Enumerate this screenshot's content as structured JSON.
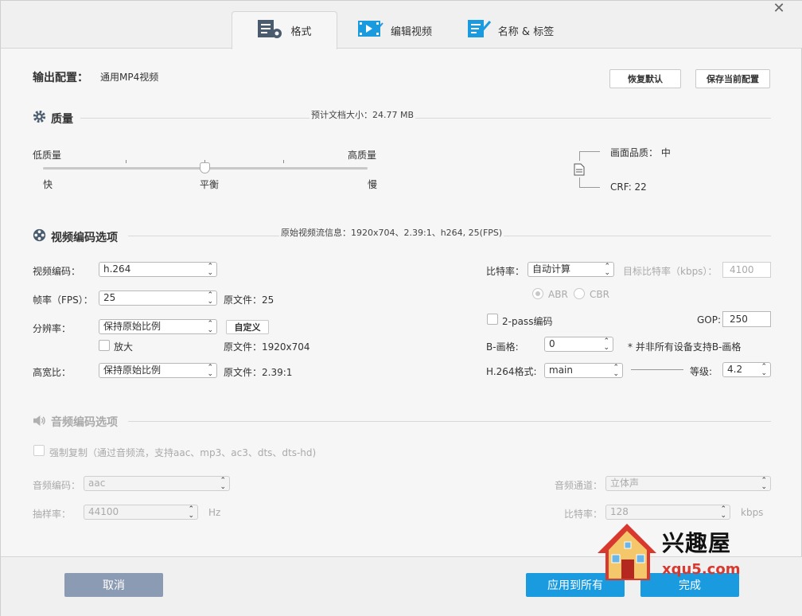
{
  "tabs": [
    {
      "label": "格式",
      "icon": "format-icon"
    },
    {
      "label": "编辑视频",
      "icon": "edit-video-icon"
    },
    {
      "label": "名称 & 标签",
      "icon": "tag-edit-icon"
    }
  ],
  "output": {
    "label": "输出配置：",
    "value": "通用MP4视频",
    "restore_default": "恢复默认",
    "save_config": "保存当前配置"
  },
  "quality": {
    "title": "质量",
    "estimated_size": "预计文档大小：24.77 MB",
    "low_label": "低质量",
    "high_label": "高质量",
    "fast_label": "快",
    "balance_label": "平衡",
    "slow_label": "慢",
    "slider_level": 0.5,
    "picture_quality": "画面品质：  中",
    "crf": "CRF: 22"
  },
  "video": {
    "title": "视频编码选项",
    "source_info": "原始视频流信息：1920x704、2.39:1、h264, 25(FPS)",
    "codec_label": "视频编码：",
    "codec_value": "h.264",
    "fps_label": "帧率（FPS）：",
    "fps_value": "25",
    "fps_source": "原文件：25",
    "resolution_label": "分辨率：",
    "resolution_value": "保持原始比例",
    "custom_label": "自定义",
    "upscale_label": "放大",
    "resolution_source": "原文件：1920x704",
    "aspect_label": "高宽比：",
    "aspect_value": "保持原始比例",
    "aspect_source": "原文件：2.39:1",
    "bitrate_label": "比特率：",
    "bitrate_value": "自动计算",
    "target_bitrate_label": "目标比特率（kbps）：",
    "target_bitrate_value": "4100",
    "abr_label": "ABR",
    "cbr_label": "CBR",
    "twopass_label": "2-pass编码",
    "gop_label": "GOP:",
    "gop_value": "250",
    "bframe_label": "B-画格:",
    "bframe_value": "0",
    "bframe_note": "* 并非所有设备支持B-画格",
    "profile_label": "H.264格式:",
    "profile_value": "main",
    "level_label": "等级:",
    "level_value": "4.2"
  },
  "audio": {
    "title": "音频编码选项",
    "force_copy_label": "强制复制（通过音频流，支持aac、mp3、ac3、dts、dts-hd)",
    "codec_label": "音频编码：",
    "codec_value": "aac",
    "samplerate_label": "抽样率：",
    "samplerate_value": "44100",
    "samplerate_unit": "Hz",
    "channel_label": "音频通道：",
    "channel_value": "立体声",
    "bitrate_label": "比特率：",
    "bitrate_value": "128",
    "bitrate_unit": "kbps"
  },
  "footer": {
    "cancel": "取消",
    "apply_all": "应用到所有",
    "done": "完成"
  },
  "watermark": {
    "brand": "兴趣屋",
    "url": "xqu5.com"
  },
  "colors": {
    "primary": "#1a9be0",
    "cancel_bg": "#8c9bb4",
    "text": "#333333",
    "disabled": "#aaaaaa"
  }
}
